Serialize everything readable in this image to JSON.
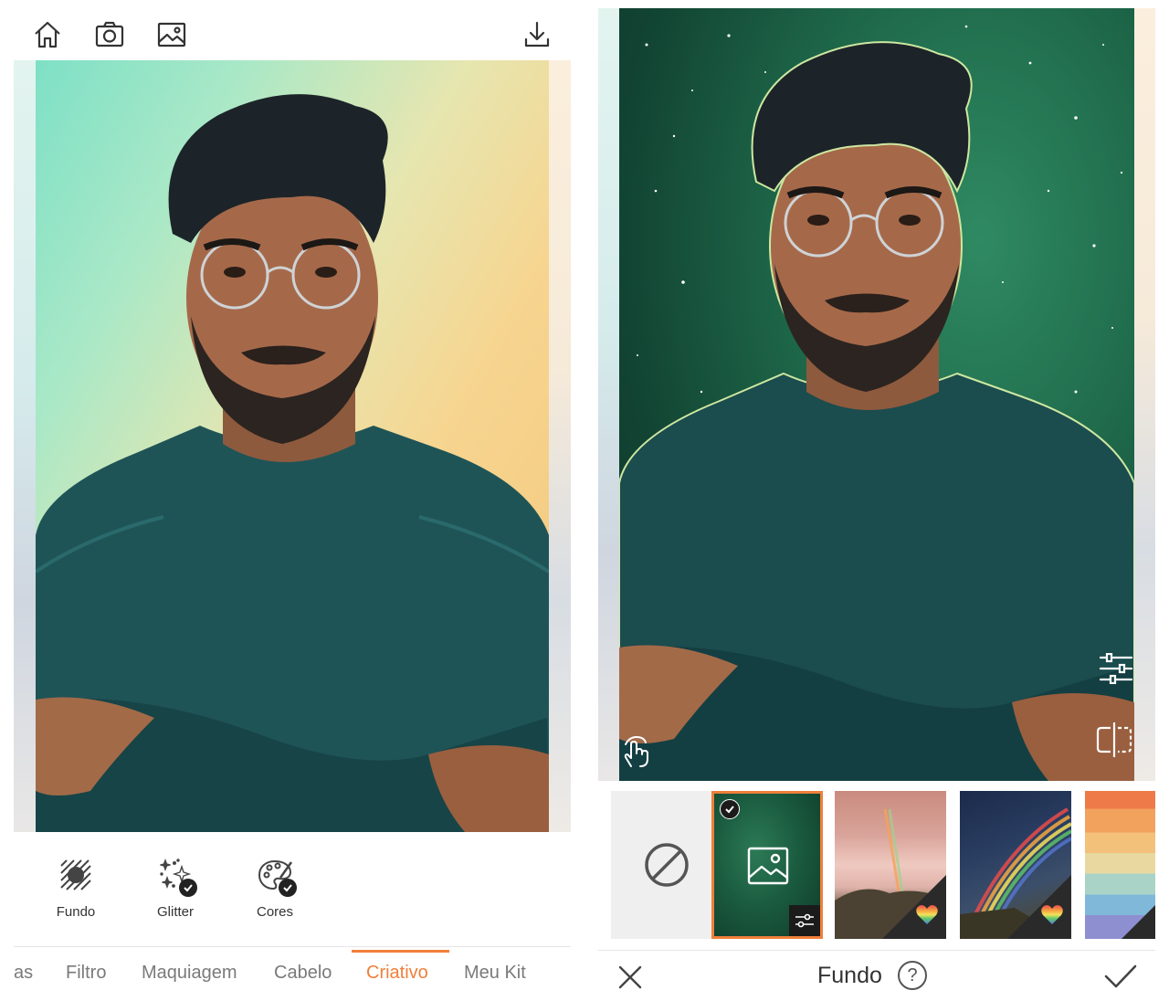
{
  "left_screen": {
    "topbar": {
      "icons": [
        "home-icon",
        "camera-icon",
        "gallery-icon",
        "download-icon"
      ]
    },
    "photo": {
      "description_icon": "portrait-photo"
    },
    "tools": [
      {
        "label": "Fundo",
        "icon": "background-icon",
        "badge": false
      },
      {
        "label": "Glitter",
        "icon": "glitter-icon",
        "badge": true
      },
      {
        "label": "Cores",
        "icon": "palette-icon",
        "badge": true
      }
    ],
    "tabs": [
      {
        "label": "as"
      },
      {
        "label": "Filtro"
      },
      {
        "label": "Maquiagem"
      },
      {
        "label": "Cabelo"
      },
      {
        "label": "Criativo",
        "active": true
      },
      {
        "label": "Meu Kit"
      }
    ],
    "accent_color": "#f07f3a"
  },
  "right_screen": {
    "photo": {
      "background": "green-galaxy"
    },
    "overlay_icons": [
      "sliders-icon",
      "compare-icon",
      "touch-icon"
    ],
    "thumbnails": [
      {
        "name": "none",
        "icon": "no-entry-icon"
      },
      {
        "name": "custom-image",
        "selected": true,
        "icon": "image-icon"
      },
      {
        "name": "sunset-rainbow",
        "premium_icon": "rainbow-heart-icon"
      },
      {
        "name": "night-rainbow",
        "premium_icon": "rainbow-heart-icon"
      },
      {
        "name": "pastel-stripes"
      }
    ],
    "bottom_bar": {
      "title": "Fundo",
      "help_label": "?"
    }
  }
}
